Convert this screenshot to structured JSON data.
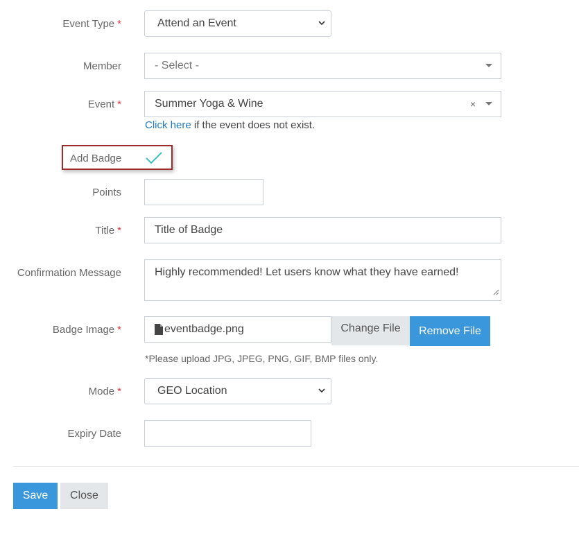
{
  "form": {
    "required_mark": "*",
    "event_type": {
      "label": "Event Type",
      "value": "Attend an Event"
    },
    "member": {
      "label": "Member",
      "value": "- Select -"
    },
    "event": {
      "label": "Event",
      "value": "Summer Yoga & Wine",
      "clear": "×",
      "help_link": "Click here",
      "help_text": " if the event does not exist."
    },
    "add_badge": {
      "label": "Add Badge",
      "checked": true
    },
    "points": {
      "label": "Points",
      "value": ""
    },
    "title": {
      "label": "Title",
      "value": "Title of Badge"
    },
    "confirmation": {
      "label": "Confirmation Message",
      "value": "Highly recommended! Let users know what they have earned!"
    },
    "badge_image": {
      "label": "Badge Image",
      "file_name": "eventbadge.png",
      "change_label": "Change File",
      "remove_label": "Remove File",
      "hint": "*Please upload JPG, JPEG, PNG, GIF, BMP files only."
    },
    "mode": {
      "label": "Mode",
      "value": "GEO Location"
    },
    "expiry": {
      "label": "Expiry Date",
      "value": ""
    }
  },
  "actions": {
    "save_label": "Save",
    "close_label": "Close"
  },
  "colors": {
    "accent": "#3b97dc",
    "check": "#3bbfbf",
    "required": "#e0383e",
    "highlight_border": "#9e2b2b"
  }
}
